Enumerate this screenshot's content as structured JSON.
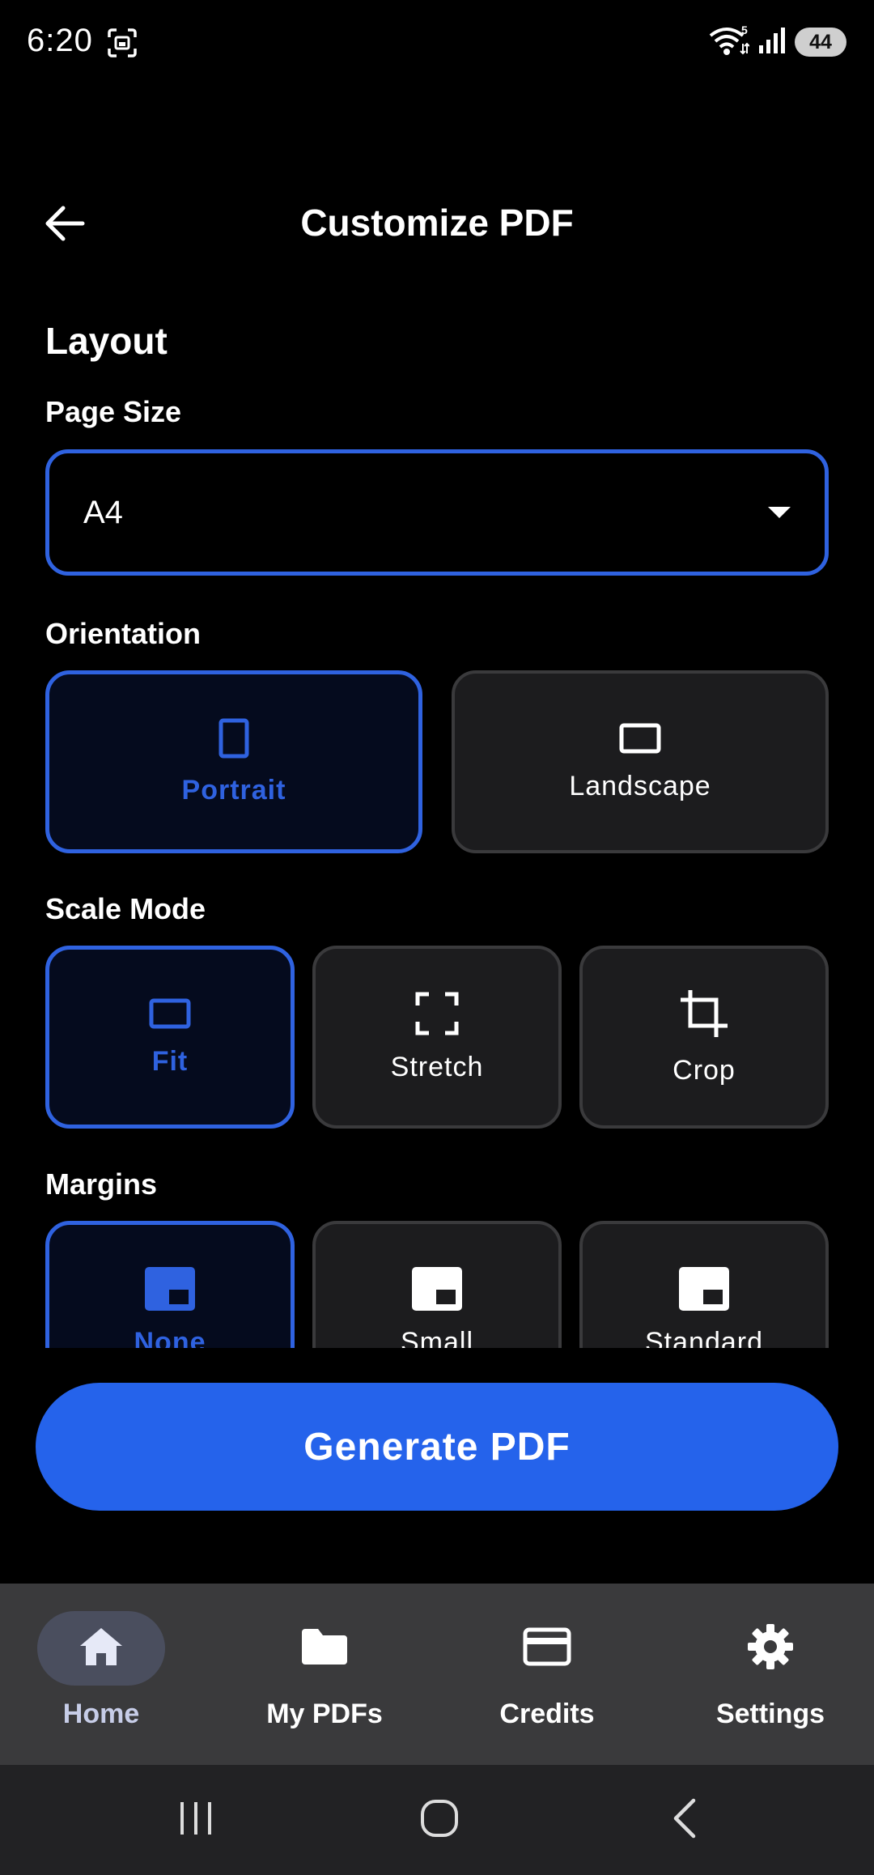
{
  "status_bar": {
    "time": "6:20",
    "battery": "44",
    "wifi_badge": "5"
  },
  "header": {
    "title": "Customize PDF"
  },
  "layout": {
    "section_title": "Layout",
    "page_size": {
      "label": "Page Size",
      "value": "A4"
    },
    "orientation": {
      "label": "Orientation",
      "options": [
        {
          "label": "Portrait",
          "icon": "portrait-icon",
          "selected": true
        },
        {
          "label": "Landscape",
          "icon": "landscape-icon",
          "selected": false
        }
      ]
    },
    "scale_mode": {
      "label": "Scale Mode",
      "options": [
        {
          "label": "Fit",
          "icon": "fit-icon",
          "selected": true
        },
        {
          "label": "Stretch",
          "icon": "stretch-icon",
          "selected": false
        },
        {
          "label": "Crop",
          "icon": "crop-icon",
          "selected": false
        }
      ]
    },
    "margins": {
      "label": "Margins",
      "options": [
        {
          "label": "None",
          "icon": "margin-none-icon",
          "selected": true
        },
        {
          "label": "Small",
          "icon": "margin-small-icon",
          "selected": false
        },
        {
          "label": "Standard",
          "icon": "margin-standard-icon",
          "selected": false
        }
      ]
    }
  },
  "actions": {
    "generate_label": "Generate PDF"
  },
  "bottom_nav": {
    "items": [
      {
        "label": "Home",
        "icon": "home-icon",
        "active": true
      },
      {
        "label": "My PDFs",
        "icon": "folder-icon",
        "active": false
      },
      {
        "label": "Credits",
        "icon": "credit-card-icon",
        "active": false
      },
      {
        "label": "Settings",
        "icon": "gear-icon",
        "active": false
      }
    ]
  },
  "colors": {
    "accent": "#2563eb",
    "selected_border": "#2f62e0",
    "card_bg": "#1c1c1e",
    "nav_bg": "#3a3a3c"
  }
}
